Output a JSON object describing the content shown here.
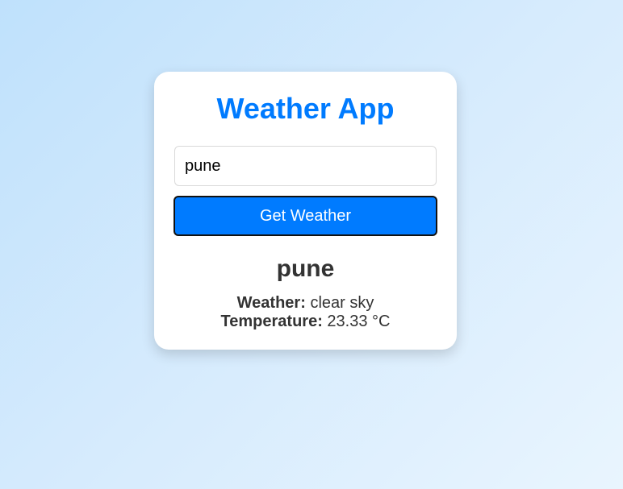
{
  "app": {
    "title": "Weather App"
  },
  "search": {
    "value": "pune",
    "button_label": "Get Weather"
  },
  "result": {
    "city": "pune",
    "weather_label": "Weather:",
    "weather_value": "clear sky",
    "temperature_label": "Temperature:",
    "temperature_value": "23.33 °C"
  },
  "colors": {
    "accent": "#007bff",
    "text": "#333333",
    "card_background": "#ffffff",
    "page_background_start": "#bfe1fc",
    "page_background_end": "#e9f5fe"
  }
}
